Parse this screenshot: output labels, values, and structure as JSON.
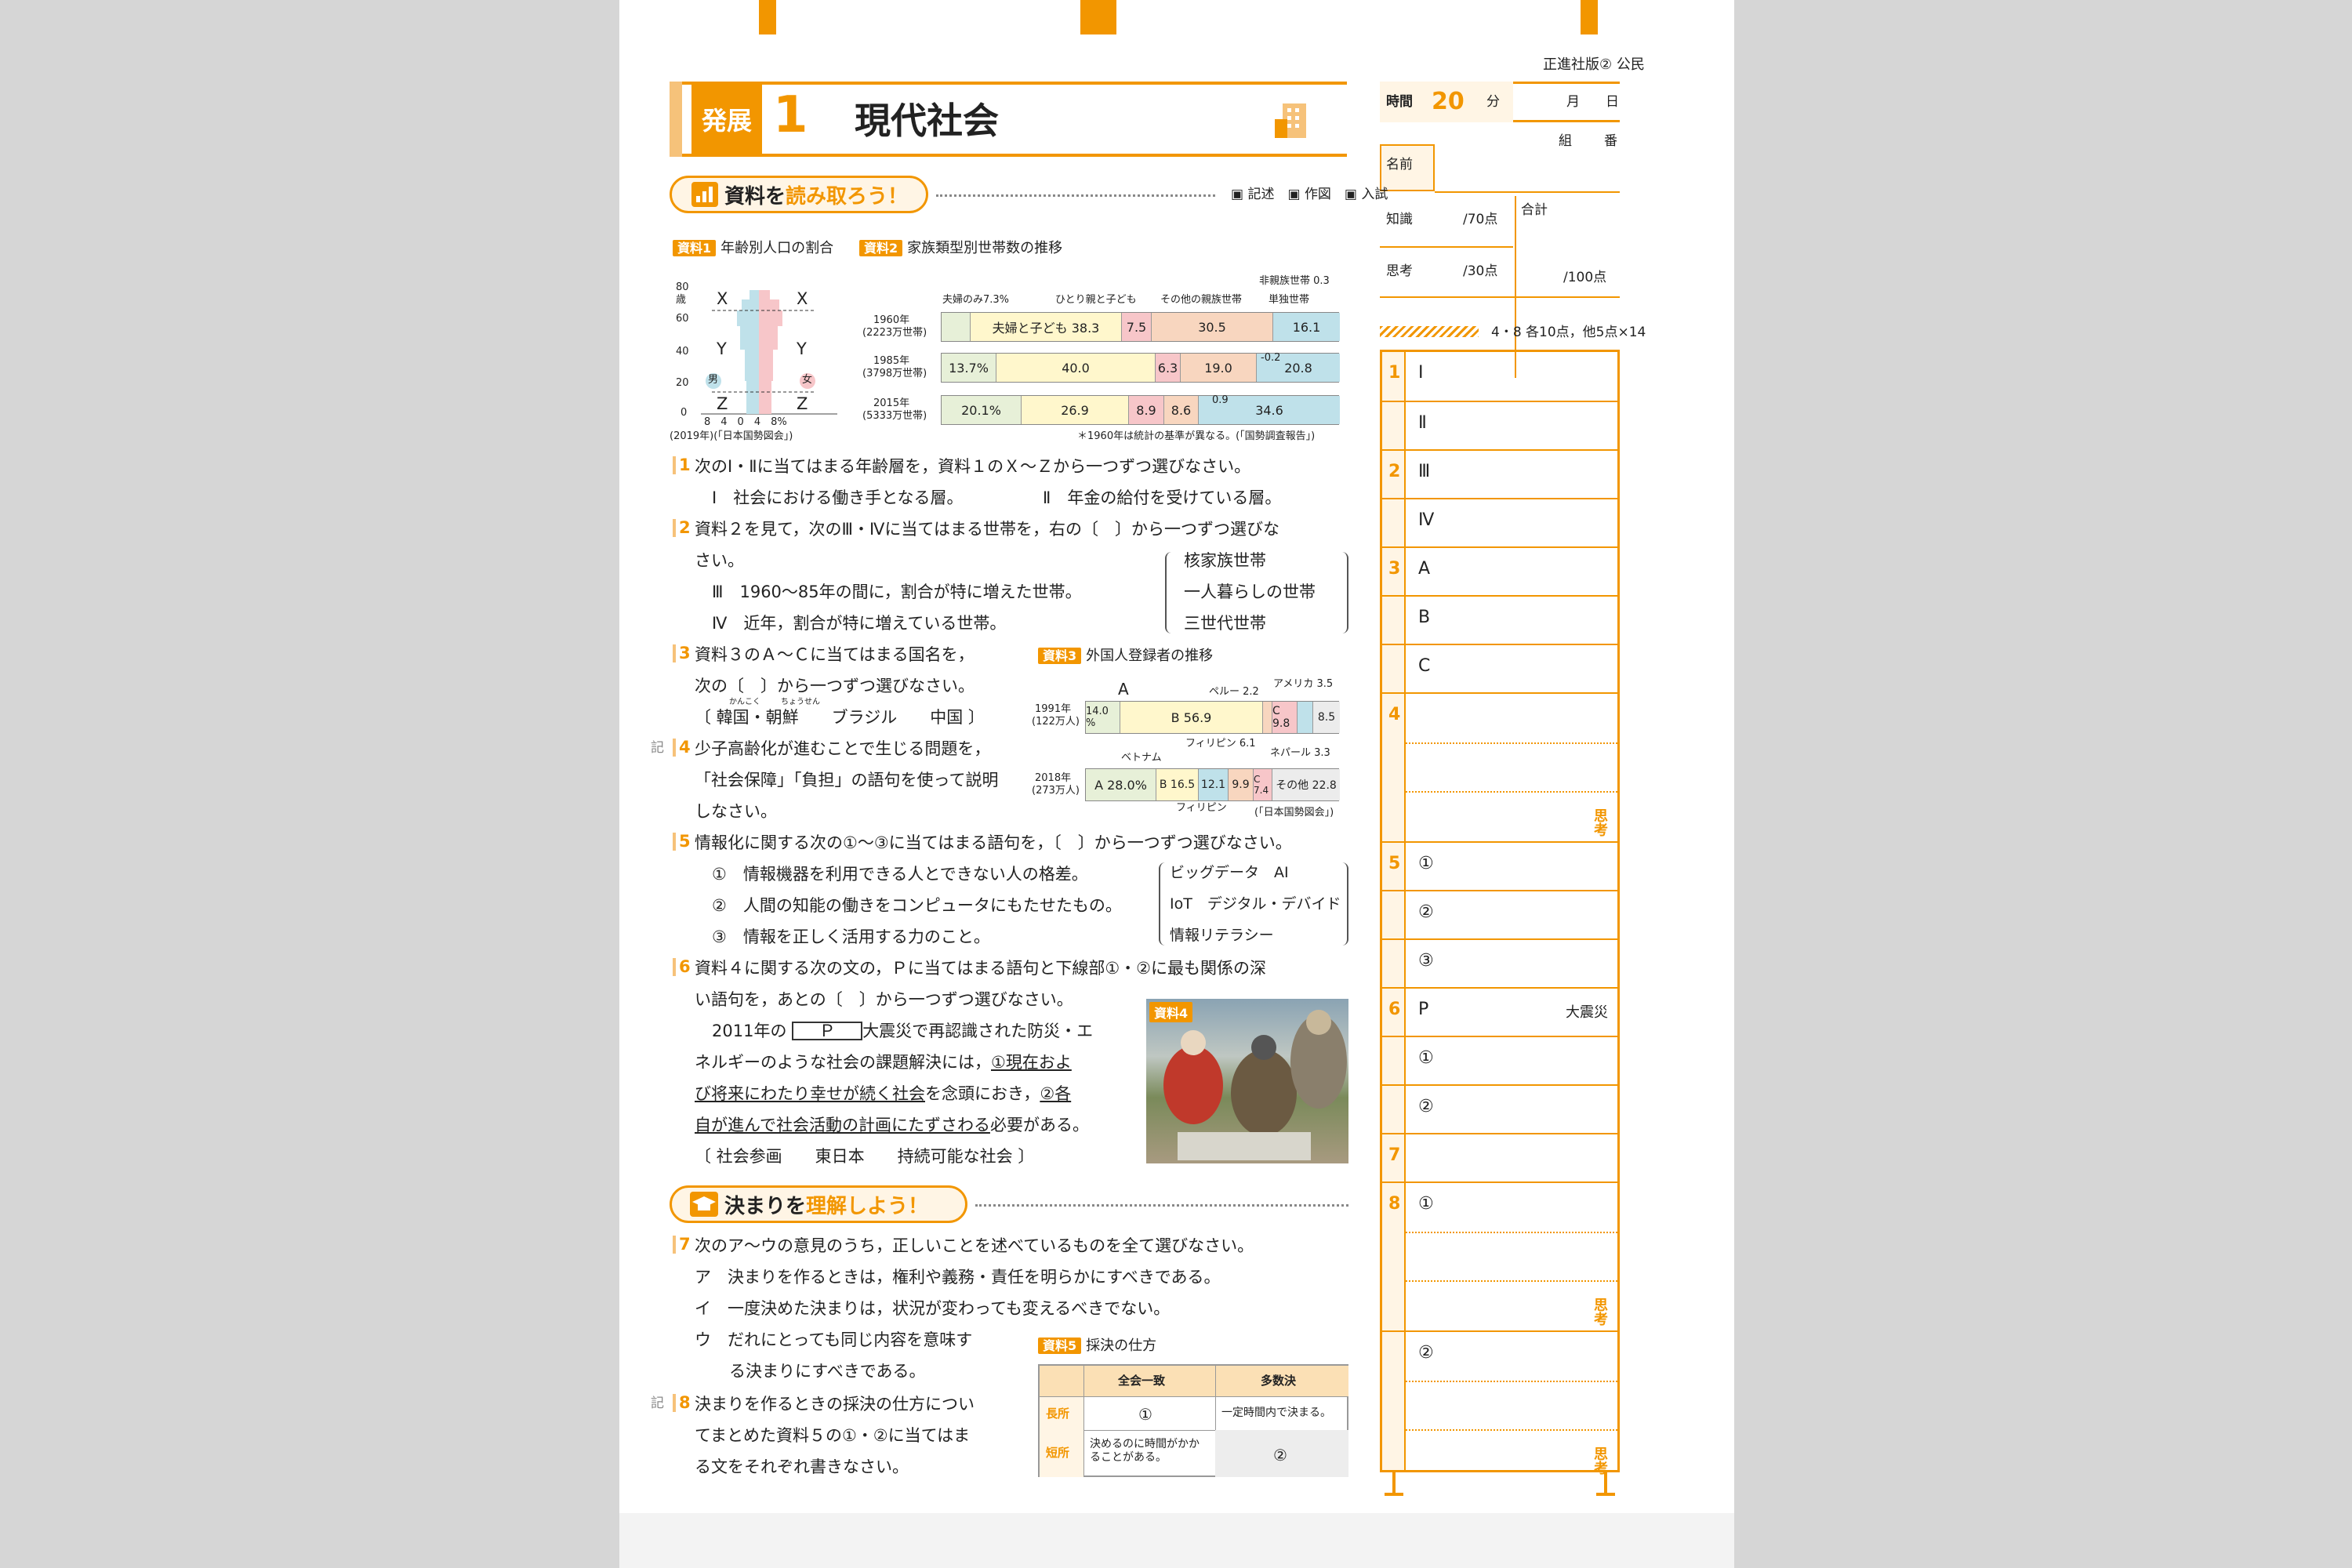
{
  "header": {
    "publisher": "正進社版② 公民",
    "badge": "発展",
    "unit_num": "1",
    "title": "現代社会"
  },
  "info": {
    "time_label": "時間",
    "time_value": "20",
    "time_unit": "分",
    "month": "月",
    "day": "日",
    "class_label": "組",
    "number_label": "番",
    "name_label": "名前",
    "knowledge_label": "知識",
    "knowledge_score": "/70点",
    "thinking_label": "思考",
    "thinking_score": "/30点",
    "total_label": "合計",
    "total_score": "/100点",
    "points_note": "4・8 各10点，他5点×14"
  },
  "section1": {
    "title_a": "資料を",
    "title_b": "読み取ろう！",
    "legend_kijutsu": "記述",
    "legend_sakuzu": "作図",
    "legend_nyushi": "入試"
  },
  "mat1": {
    "label": "資料1",
    "caption": "年齢別人口の割合",
    "ticks": [
      "80",
      "60",
      "40",
      "20",
      "0"
    ],
    "unit": "歳",
    "letters": [
      "X",
      "Y",
      "Z"
    ],
    "male": "男",
    "female": "女",
    "xticks": "8　4　0　4　8%",
    "source": "(2019年)(「日本国勢図会」)"
  },
  "mat2": {
    "label": "資料2",
    "caption": "家族類型別世帯数の推移",
    "rows": [
      {
        "year": "1960年",
        "count": "(2223万世帯)",
        "vals": [
          "夫婦と子ども 38.3",
          "7.5",
          "30.5",
          "16.1"
        ]
      },
      {
        "year": "1985年",
        "count": "(3798万世帯)",
        "vals": [
          "13.7%",
          "40.0",
          "6.3",
          "19.0",
          "20.8"
        ]
      },
      {
        "year": "2015年",
        "count": "(5333万世帯)",
        "vals": [
          "20.1%",
          "26.9",
          "8.9",
          "8.6",
          "34.6"
        ]
      }
    ],
    "top_labels": [
      "夫婦のみ7.3%",
      "ひとり親と子ども",
      "その他の親族世帯",
      "非親族世帯 0.3",
      "単独世帯"
    ],
    "small": [
      "-0.2",
      "0.9"
    ],
    "note": "＊1960年は統計の基準が異なる。(「国勢調査報告」)"
  },
  "q1": {
    "num": "1",
    "text": "次のⅠ・Ⅱに当てはまる年齢層を，資料１のＸ～Ｚから一つずつ選びなさい。",
    "opt1": "Ⅰ　社会における働き手となる層。",
    "opt2": "Ⅱ　年金の給付を受けている層。"
  },
  "q2": {
    "num": "2",
    "text1": "資料２を見て，次のⅢ・Ⅳに当てはまる世帯を，右の〔　〕から一つずつ選びな",
    "text2": "さい。",
    "opt3": "Ⅲ　1960～85年の間に，割合が特に増えた世帯。",
    "opt4": "Ⅳ　近年，割合が特に増えている世帯。",
    "choices": [
      "核家族世帯",
      "一人暮らしの世帯",
      "三世代世帯"
    ]
  },
  "q3": {
    "num": "3",
    "text1": "資料３のＡ～Ｃに当てはまる国名を，",
    "text2": "次の〔　〕から一つずつ選びなさい。",
    "choices": "〔 韓国・朝鮮　　ブラジル　　中国 〕",
    "ruby1": "かんこく",
    "ruby2": "ちょうせん"
  },
  "mat3": {
    "label": "資料3",
    "caption": "外国人登録者の推移",
    "r1_year": "1991年",
    "r1_count": "(122万人)",
    "r1_vals": [
      "14.0 %",
      "B 56.9",
      "C 9.8",
      "8.5"
    ],
    "r2_year": "2018年",
    "r2_count": "(273万人)",
    "r2_vals": [
      "A 28.0%",
      "B 16.5",
      "12.1",
      "9.9",
      "C 7.4",
      "その他 22.8"
    ],
    "ann": [
      "A",
      "ペルー 2.2",
      "アメリカ 3.5",
      "フィリピン 6.1",
      "ベトナム",
      "ネパール 3.3",
      "フィリピン"
    ],
    "source": "(「日本国勢図会」)"
  },
  "q4": {
    "num": "4",
    "text1": "少子高齢化が進むことで生じる問題を，",
    "text2": "「社会保障」「負担」の語句を使って説明",
    "text3": "しなさい。",
    "mark": "記"
  },
  "q5": {
    "num": "5",
    "text": "情報化に関する次の①～③に当てはまる語句を，〔　〕から一つずつ選びなさい。",
    "o1": "①　情報機器を利用できる人とできない人の格差。",
    "o2": "②　人間の知能の働きをコンピュータにもたせたもの。",
    "o3": "③　情報を正しく活用する力のこと。",
    "choices": [
      "ビッグデータ　AI",
      "IoT　デジタル・デバイド",
      "情報リテラシー"
    ]
  },
  "q6": {
    "num": "6",
    "text1": "資料４に関する次の文の，Ｐに当てはまる語句と下線部①・②に最も関係の深",
    "text2": "い語句を，あとの〔　〕から一つずつ選びなさい。",
    "p1a": "2011年の",
    "p1box": "Ｐ",
    "p1b": "大震災で再認識された防災・エ",
    "p2a": "ネルギーのような社会の課題解決には，",
    "p2b": "①現在およ",
    "p3": "び将来にわたり幸せが続く社会",
    "p3b": "を念頭におき，",
    "p3c": "②各",
    "p4": "自が進んで社会活動の計画にたずさわる",
    "p4b": "必要がある。",
    "choices": "〔 社会参画　　東日本　　持続可能な社会 〕",
    "mat_label": "資料4"
  },
  "section2": {
    "title_a": "決まりを",
    "title_b": "理解しよう！"
  },
  "q7": {
    "num": "7",
    "text": "次のア～ウの意見のうち，正しいことを述べているものを全て選びなさい。",
    "a": "ア　決まりを作るときは，権利や義務・責任を明らかにすべきである。",
    "i": "イ　一度決めた決まりは，状況が変わっても変えるべきでない。",
    "u1": "ウ　だれにとっても同じ内容を意味す",
    "u2": "る決まりにすべきである。"
  },
  "q8": {
    "num": "8",
    "text1": "決まりを作るときの採決の仕方につい",
    "text2": "てまとめた資料５の①・②に当てはま",
    "text3": "る文をそれぞれ書きなさい。",
    "mark": "記"
  },
  "mat5": {
    "label": "資料5",
    "caption": "採決の仕方",
    "h1": "全会一致",
    "h2": "多数決",
    "r1": "長所",
    "r1c1": "①",
    "r1c2": "一定時間内で決まる。",
    "r2": "短所",
    "r2c1": "決めるのに時間がかかることがある。",
    "r2c2": "②"
  },
  "answers": {
    "rows": [
      {
        "n": "1",
        "s": "Ⅰ"
      },
      {
        "n": "",
        "s": "Ⅱ"
      },
      {
        "n": "2",
        "s": "Ⅲ"
      },
      {
        "n": "",
        "s": "Ⅳ"
      },
      {
        "n": "3",
        "s": "A"
      },
      {
        "n": "",
        "s": "B"
      },
      {
        "n": "",
        "s": "C"
      },
      {
        "n": "4",
        "s": ""
      },
      {
        "n": "5",
        "s": "①"
      },
      {
        "n": "",
        "s": "②"
      },
      {
        "n": "",
        "s": "③"
      },
      {
        "n": "6",
        "s": "P"
      },
      {
        "n": "",
        "s": "①"
      },
      {
        "n": "",
        "s": "②"
      },
      {
        "n": "7",
        "s": ""
      },
      {
        "n": "8",
        "s": "①"
      },
      {
        "n": "",
        "s": "②"
      }
    ],
    "daishinsai": "大震災",
    "omo": "思考"
  },
  "colors": {
    "accent": "#f29600",
    "pale": "#fff5e5"
  }
}
